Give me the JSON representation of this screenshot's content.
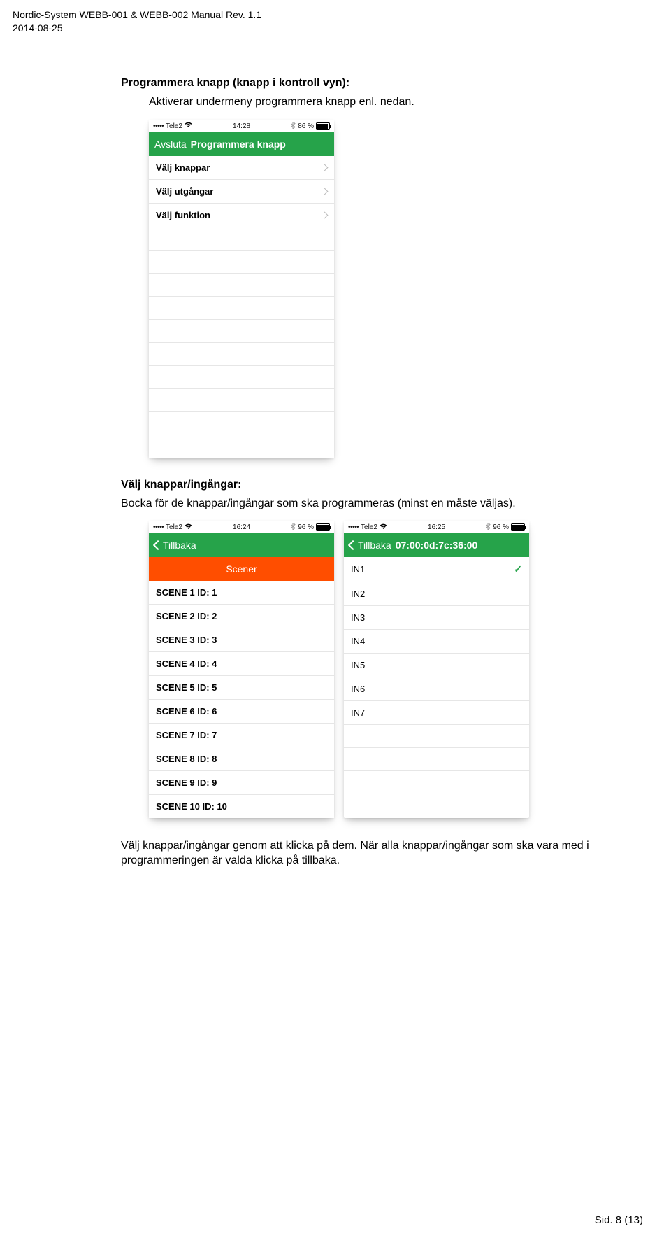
{
  "header": {
    "line1": "Nordic-System WEBB-001 & WEBB-002 Manual Rev. 1.1",
    "line2": "2014-08-25"
  },
  "section1": {
    "heading": "Programmera knapp (knapp i kontroll vyn):",
    "body": "Aktiverar undermeny programmera knapp enl. nedan."
  },
  "phone1": {
    "status": {
      "carrier": "Tele2",
      "time": "14:28",
      "battery_pct": "86 %",
      "battery_fill_pct": 86
    },
    "nav": {
      "back": "Avsluta",
      "title": "Programmera knapp"
    },
    "rows": [
      "Välj knappar",
      "Välj utgångar",
      "Välj funktion"
    ]
  },
  "section2": {
    "heading": "Välj knappar/ingångar:",
    "body": "Bocka för de knappar/ingångar som ska programmeras (minst en måste väljas)."
  },
  "phone2": {
    "status": {
      "carrier": "Tele2",
      "time": "16:24",
      "battery_pct": "96 %",
      "battery_fill_pct": 96
    },
    "nav": {
      "back": "Tillbaka"
    },
    "scener_label": "Scener",
    "scenes": [
      "SCENE 1 ID: 1",
      "SCENE 2 ID: 2",
      "SCENE 3 ID: 3",
      "SCENE 4 ID: 4",
      "SCENE 5 ID: 5",
      "SCENE 6 ID: 6",
      "SCENE 7 ID: 7",
      "SCENE 8 ID: 8",
      "SCENE 9 ID: 9",
      "SCENE 10 ID: 10"
    ]
  },
  "phone3": {
    "status": {
      "carrier": "Tele2",
      "time": "16:25",
      "battery_pct": "96 %",
      "battery_fill_pct": 96
    },
    "nav": {
      "back": "Tillbaka",
      "title": "07:00:0d:7c:36:00"
    },
    "inputs": [
      "IN1",
      "IN2",
      "IN3",
      "IN4",
      "IN5",
      "IN6",
      "IN7"
    ],
    "checked_index": 0
  },
  "section3": {
    "body": "Välj knappar/ingångar genom att klicka på dem. När alla knappar/ingångar som ska vara med i programmeringen är valda klicka på tillbaka."
  },
  "footer": "Sid. 8 (13)"
}
